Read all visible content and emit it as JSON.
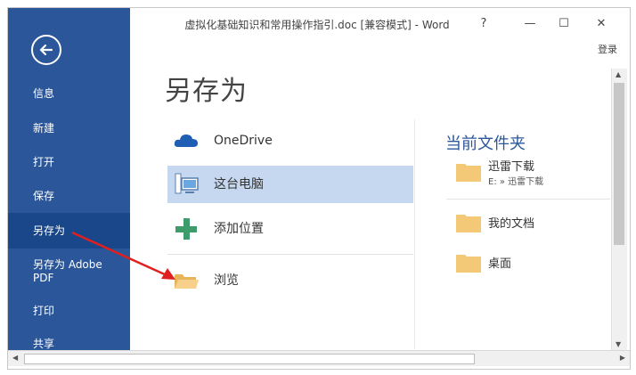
{
  "window": {
    "title": "虚拟化基础知识和常用操作指引.doc [兼容模式] - Word",
    "help_label": "?",
    "minimize_label": "—",
    "restore_label": "☐",
    "close_label": "✕",
    "login_label": "登录"
  },
  "sidebar": {
    "back_icon": "back-arrow-icon",
    "items": [
      {
        "label": "信息",
        "active": false
      },
      {
        "label": "新建",
        "active": false
      },
      {
        "label": "打开",
        "active": false
      },
      {
        "label": "保存",
        "active": false
      },
      {
        "label": "另存为",
        "active": true
      },
      {
        "label": "另存为 Adobe\nPDF",
        "active": false
      },
      {
        "label": "打印",
        "active": false
      },
      {
        "label": "共享",
        "active": false
      }
    ]
  },
  "main": {
    "heading": "另存为",
    "places": [
      {
        "label": "OneDrive",
        "icon": "cloud-icon",
        "selected": false
      },
      {
        "label": "这台电脑",
        "icon": "computer-icon",
        "selected": true
      },
      {
        "label": "添加位置",
        "icon": "plus-icon",
        "selected": false
      },
      {
        "label": "浏览",
        "icon": "folder-icon",
        "selected": false
      }
    ]
  },
  "current_folder": {
    "title": "当前文件夹",
    "items": [
      {
        "name": "迅雷下载",
        "path": "E: » 迅雷下载"
      },
      {
        "name": "我的文档",
        "path": ""
      },
      {
        "name": "桌面",
        "path": ""
      }
    ]
  },
  "colors": {
    "sidebar": "#2b579a",
    "active": "#19478a",
    "selected_place": "#c5d8f0",
    "folder": "#f7c56e",
    "annotation_arrow": "#e02020"
  }
}
